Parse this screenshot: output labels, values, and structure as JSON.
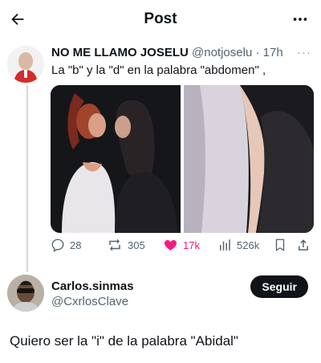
{
  "header": {
    "title": "Post",
    "back_icon": "arrow-left-icon",
    "more_icon": "more-horizontal-icon"
  },
  "original_post": {
    "display_name": "NO ME LLAMO JOSELU",
    "handle": "@notjoselu",
    "separator": "·",
    "time": "17h",
    "more": "···",
    "text": "La \"b\" y la \"d\" en la palabra \"abdomen\" ,",
    "stats": {
      "replies": "28",
      "reposts": "305",
      "likes": "17k",
      "views": "526k"
    }
  },
  "reply": {
    "display_name": "Carlos.sinmas",
    "handle": "@CxrlosClave",
    "follow_label": "Seguir",
    "text": "Quiero ser la \"i\" de la palabra \"Abidal\""
  },
  "colors": {
    "text": "#0f1419",
    "secondary": "#536471",
    "like": "#f91880",
    "thread_line": "#cfd9de"
  }
}
